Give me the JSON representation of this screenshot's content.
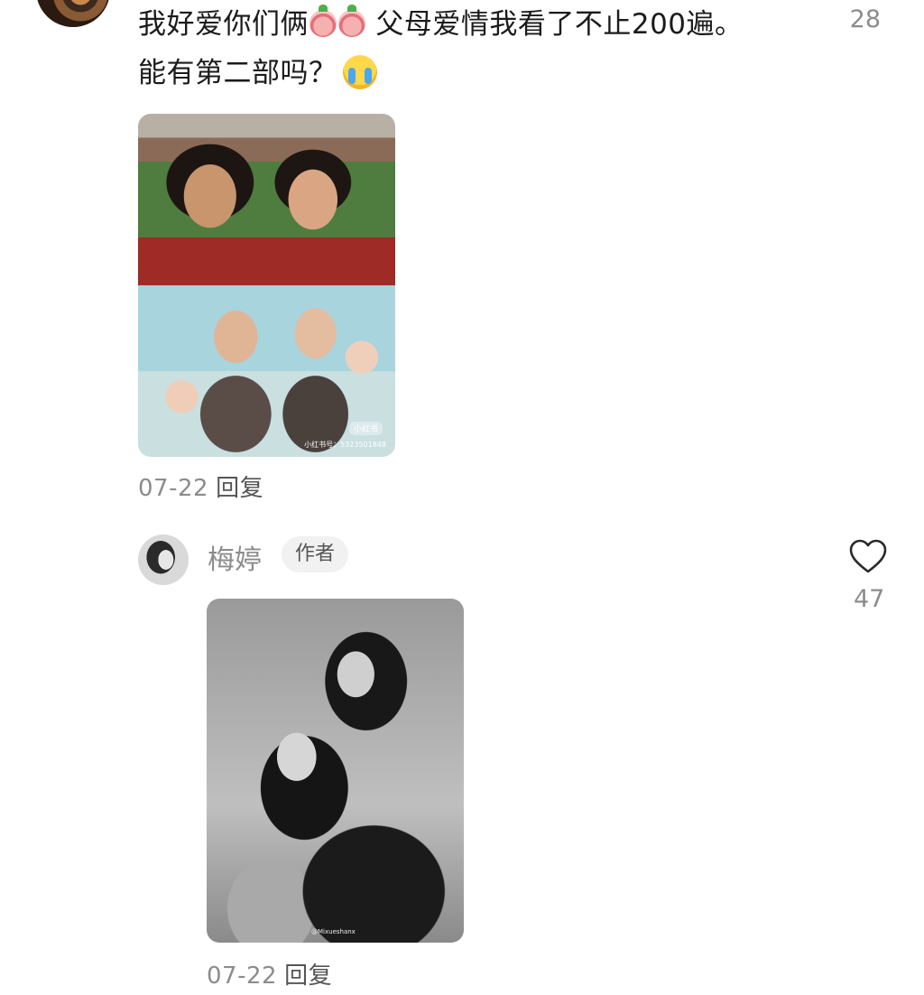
{
  "comment": {
    "text_part1": "我好爱你们俩",
    "text_part2": " 父母爱情我看了不止200遍。",
    "text_part3": "能有第二部吗？",
    "like_count": "28",
    "photo_watermark_brand": "小红书",
    "photo_watermark_id": "小红书号：5323501848",
    "date": "07-22",
    "reply_label": "回复"
  },
  "reply": {
    "author_name": "梅婷",
    "author_tag": "作者",
    "like_count": "47",
    "photo_watermark": "@Mixueshanx",
    "date": "07-22",
    "reply_label": "回复"
  },
  "icons": {
    "heart": "heart-outline-icon",
    "emoji_face": "peach-face-emoji-icon",
    "emoji_cry": "loudly-crying-face-icon"
  }
}
